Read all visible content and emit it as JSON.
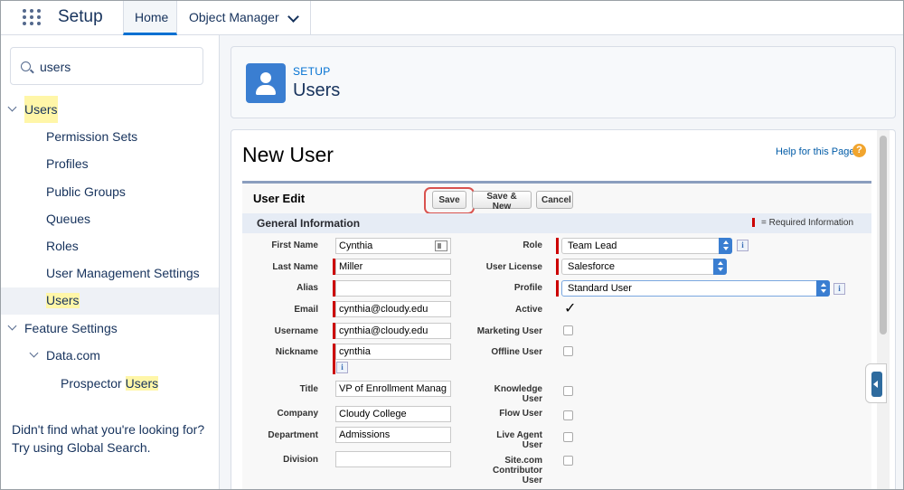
{
  "topbar": {
    "app_title": "Setup",
    "tabs": [
      {
        "label": "Home"
      },
      {
        "label": "Object Manager"
      }
    ]
  },
  "sidebar": {
    "search": {
      "value": "users",
      "icon": "search-icon"
    },
    "tree": {
      "users_group": "Users",
      "children": [
        {
          "label": "Permission Sets"
        },
        {
          "label": "Profiles"
        },
        {
          "label": "Public Groups"
        },
        {
          "label": "Queues"
        },
        {
          "label": "Roles"
        },
        {
          "label": "User Management Settings"
        },
        {
          "label": "Users"
        }
      ],
      "feature_settings": "Feature Settings",
      "datacom": "Data.com",
      "prospector_prefix": "Prospector ",
      "prospector_hl": "Users"
    },
    "not_found_line1": "Didn't find what you're looking for?",
    "not_found_line2": "Try using Global Search."
  },
  "header": {
    "eyebrow": "SETUP",
    "title": "Users"
  },
  "page": {
    "heading": "New User",
    "help_link": "Help for this Page",
    "help_icon_glyph": "?"
  },
  "edit": {
    "title": "User Edit",
    "save_label": "Save",
    "save_new_label": "Save & New",
    "cancel_label": "Cancel",
    "section_title": "General Information",
    "required_info": "= Required Information"
  },
  "form": {
    "left": {
      "first_name": {
        "label": "First Name",
        "value": "Cynthia"
      },
      "last_name": {
        "label": "Last Name",
        "value": "Miller"
      },
      "alias": {
        "label": "Alias",
        "value": ""
      },
      "email": {
        "label": "Email",
        "value": "cynthia@cloudy.edu"
      },
      "username": {
        "label": "Username",
        "value": "cynthia@cloudy.edu"
      },
      "nickname": {
        "label": "Nickname",
        "value": "cynthia"
      },
      "title": {
        "label": "Title",
        "value": "VP of Enrollment Manag"
      },
      "company": {
        "label": "Company",
        "value": "Cloudy College"
      },
      "department": {
        "label": "Department",
        "value": "Admissions"
      },
      "division": {
        "label": "Division",
        "value": ""
      }
    },
    "right": {
      "role": {
        "label": "Role",
        "value": "Team Lead"
      },
      "user_license": {
        "label": "User License",
        "value": "Salesforce"
      },
      "profile": {
        "label": "Profile",
        "value": "Standard User"
      },
      "active": {
        "label": "Active",
        "checked": true
      },
      "marketing_user": {
        "label": "Marketing User"
      },
      "offline_user": {
        "label": "Offline User"
      },
      "knowledge_user_l1": "Knowledge",
      "knowledge_user_l2": "User",
      "flow_user": {
        "label": "Flow User"
      },
      "live_agent_l1": "Live Agent",
      "live_agent_l2": "User",
      "sitecom_l1": "Site.com",
      "sitecom_l2": "Contributor",
      "sitecom_l3": "User"
    },
    "info_glyph": "i",
    "check_glyph": "✓"
  },
  "colors": {
    "brand_blue": "#0070d2",
    "required_red": "#cc0000",
    "highlight_ring": "#d9534f",
    "search_highlight": "#fff6a8"
  }
}
